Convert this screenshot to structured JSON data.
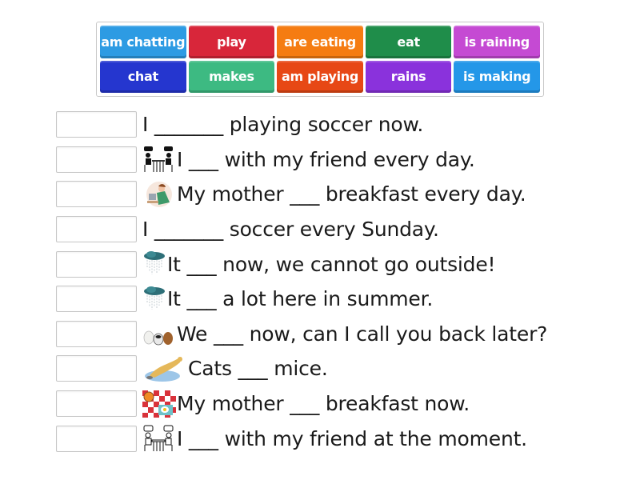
{
  "word_bank": {
    "tiles": [
      {
        "label": "am chatting",
        "color": "#2d9be3"
      },
      {
        "label": "play",
        "color": "#d8263a"
      },
      {
        "label": "are eating",
        "color": "#f57c12"
      },
      {
        "label": "eat",
        "color": "#1f8d4a"
      },
      {
        "label": "is raining",
        "color": "#c54ad3"
      },
      {
        "label": "chat",
        "color": "#2536cf"
      },
      {
        "label": "makes",
        "color": "#3dba82"
      },
      {
        "label": "am playing",
        "color": "#e74815"
      },
      {
        "label": "rains",
        "color": "#8a32dc"
      },
      {
        "label": "is making",
        "color": "#2497e8"
      }
    ]
  },
  "questions": [
    {
      "image": "none",
      "text": "I _______ playing soccer now."
    },
    {
      "image": "people-chatting-icon",
      "text": "I ___ with my friend every day."
    },
    {
      "image": "mother-cooking-icon",
      "text": "My mother ___ breakfast every day."
    },
    {
      "image": "none",
      "text": "I _______ soccer every Sunday."
    },
    {
      "image": "rain-cloud-icon",
      "text": "It ___ now, we cannot go outside!"
    },
    {
      "image": "rain-cloud-icon",
      "text": "It ___ a lot here in summer."
    },
    {
      "image": "three-bears-icon",
      "text": "We ___ now, can I call you back later?"
    },
    {
      "image": "cat-catching-mouse-icon",
      "text": "Cats ___ mice."
    },
    {
      "image": "breakfast-table-icon",
      "text": "My mother ___ breakfast now."
    },
    {
      "image": "people-chatting-outline-icon",
      "text": "I ___ with my friend at the moment."
    }
  ]
}
